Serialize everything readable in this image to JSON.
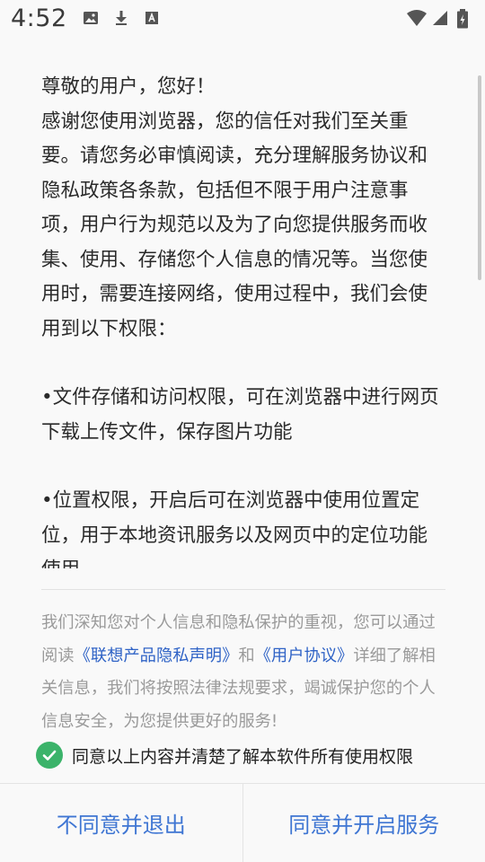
{
  "status_bar": {
    "time": "4:52",
    "icons_left": [
      "image-icon",
      "download-icon",
      "text-a-icon"
    ],
    "icons_right": [
      "wifi-icon",
      "signal-icon",
      "battery-icon"
    ]
  },
  "notice": {
    "greeting": "尊敬的用户，您好！",
    "para1": "感谢您使用浏览器，您的信任对我们至关重要。请您务必审慎阅读，充分理解服务协议和隐私政策各条款，包括但不限于用户注意事项，用户行为规范以及为了向您提供服务而收集、使用、存储您个人信息的情况等。当您使用时，需要连接网络，使用过程中，我们会使用到以下权限：",
    "perm_storage": "•文件存储和访问权限，可在浏览器中进行网页下载上传文件，保存图片功能",
    "perm_location": "•位置权限，开启后可在浏览器中使用位置定位，用于本地资讯服务以及网页中的定位功能使用"
  },
  "summary": {
    "text_before": "我们深知您对个人信息和隐私保护的重视，您可以通过阅读",
    "link_privacy": "《联想产品隐私声明》",
    "text_and": "和",
    "link_agreement": "《用户协议》",
    "text_after": "详细了解相关信息，我们将按照法律法规要求，竭诚保护您的个人信息安全，为您提供更好的服务!"
  },
  "agree": {
    "label": "同意以上内容并清楚了解本软件所有使用权限",
    "checked": true
  },
  "buttons": {
    "decline": "不同意并退出",
    "accept": "同意并开启服务"
  },
  "colors": {
    "link": "#2f63c6",
    "button_text": "#3f76d3",
    "check_green": "#3bb36a"
  }
}
